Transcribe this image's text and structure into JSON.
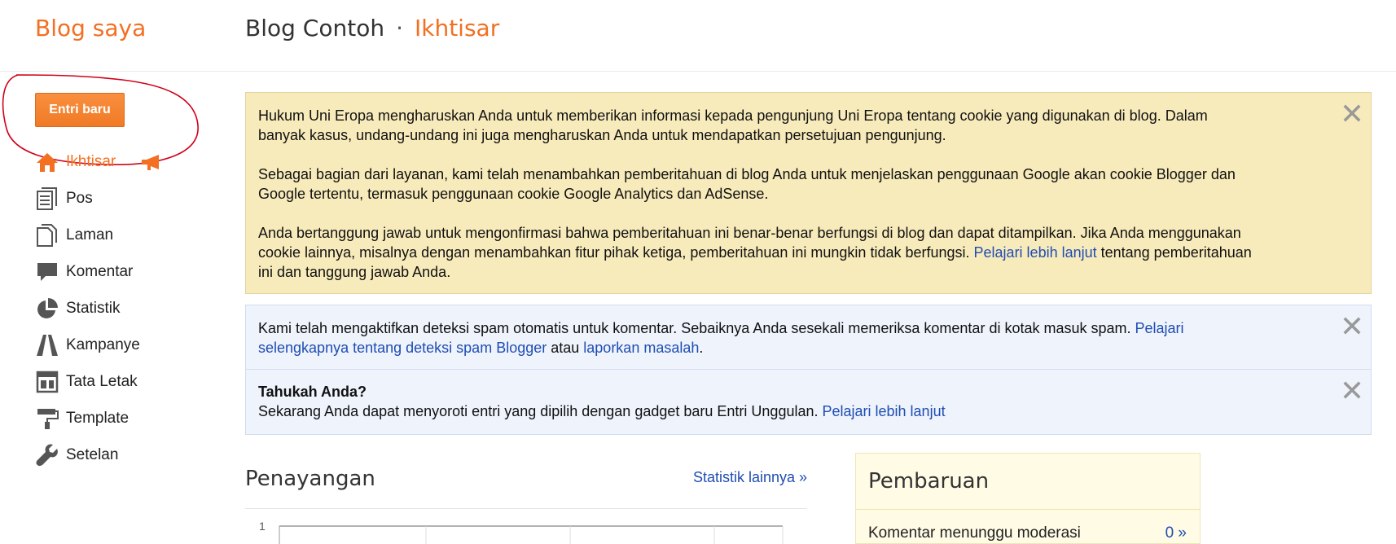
{
  "header": {
    "brand": "Blog saya",
    "blog_name": "Blog Contoh",
    "separator": "·",
    "section": "Ikhtisar"
  },
  "sidebar": {
    "new_post_label": "Entri baru",
    "items": [
      {
        "label": "Ikhtisar",
        "icon": "home-icon",
        "active": true
      },
      {
        "label": "Pos",
        "icon": "posts-icon"
      },
      {
        "label": "Laman",
        "icon": "pages-icon"
      },
      {
        "label": "Komentar",
        "icon": "comment-icon"
      },
      {
        "label": "Statistik",
        "icon": "pie-chart-icon"
      },
      {
        "label": "Kampanye",
        "icon": "campaign-icon"
      },
      {
        "label": "Tata Letak",
        "icon": "layout-icon"
      },
      {
        "label": "Template",
        "icon": "paint-roller-icon"
      },
      {
        "label": "Setelan",
        "icon": "wrench-icon"
      }
    ]
  },
  "notices": {
    "cookie": {
      "p1": "Hukum Uni Eropa mengharuskan Anda untuk memberikan informasi kepada pengunjung Uni Eropa tentang cookie yang digunakan di blog. Dalam banyak kasus, undang-undang ini juga mengharuskan Anda untuk mendapatkan persetujuan pengunjung.",
      "p2": "Sebagai bagian dari layanan, kami telah menambahkan pemberitahuan di blog Anda untuk menjelaskan penggunaan Google akan cookie Blogger dan Google tertentu, termasuk penggunaan cookie Google Analytics dan AdSense.",
      "p3_before": "Anda bertanggung jawab untuk mengonfirmasi bahwa pemberitahuan ini benar-benar berfungsi di blog dan dapat ditampilkan. Jika Anda menggunakan cookie lainnya, misalnya dengan menambahkan fitur pihak ketiga, pemberitahuan ini mungkin tidak berfungsi. ",
      "p3_link": "Pelajari lebih lanjut",
      "p3_after": " tentang pemberitahuan ini dan tanggung jawab Anda."
    },
    "spam": {
      "text": "Kami telah mengaktifkan deteksi spam otomatis untuk komentar. Sebaiknya Anda sesekali memeriksa komentar di kotak masuk spam. ",
      "link1": "Pelajari selengkapnya tentang deteksi spam Blogger",
      "middle": " atau ",
      "link2": "laporkan masalah",
      "end": "."
    },
    "tip": {
      "title": "Tahukah Anda?",
      "text": "Sekarang Anda dapat menyoroti entri yang dipilih dengan gadget baru Entri Unggulan. ",
      "link": "Pelajari lebih lanjut"
    }
  },
  "stats": {
    "title": "Penayangan",
    "more_link": "Statistik lainnya »",
    "chart_y_tick": "1"
  },
  "updates": {
    "title": "Pembaruan",
    "pending_label": "Komentar menunggu moderasi",
    "pending_value": "0 »"
  },
  "colors": {
    "accent": "#f36f21",
    "link": "#1f4db3",
    "cookie_bg": "#f8ebbb",
    "info_bg": "#eef3fc",
    "updates_bg": "#fffbe5",
    "annotation": "#d0021b"
  }
}
